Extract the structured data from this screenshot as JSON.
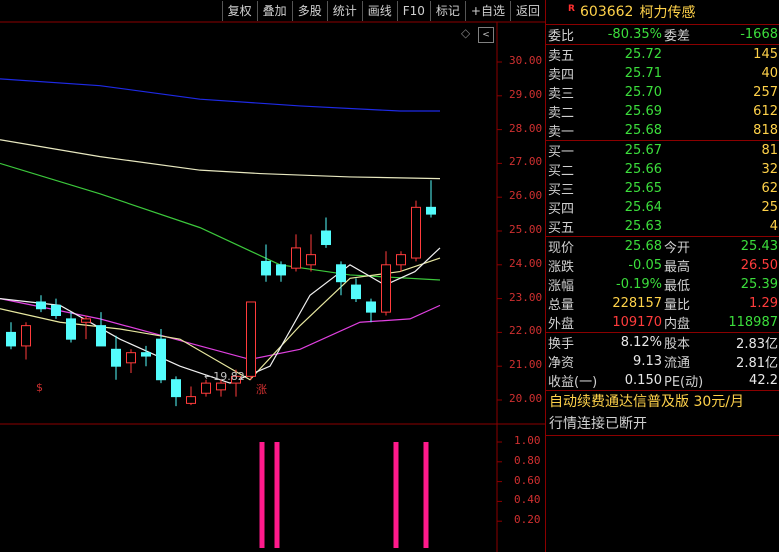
{
  "toolbar": [
    "复权",
    "叠加",
    "多股",
    "统计",
    "画线",
    "F10",
    "标记",
    "+自选",
    "返回"
  ],
  "price_axis": [
    "30.00",
    "29.00",
    "28.00",
    "27.00",
    "26.00",
    "25.00",
    "24.00",
    "23.00",
    "22.00",
    "21.00",
    "20.00"
  ],
  "indicator_axis": [
    "1.00",
    "0.80",
    "0.60",
    "0.40",
    "0.20"
  ],
  "low_annotation": "←19.82",
  "markers": {
    "left": "$",
    "mid": "涨"
  },
  "chart_data": {
    "type": "candlestick",
    "ylim": [
      19.6,
      30.4
    ],
    "candles": [
      {
        "o": 22.0,
        "h": 22.3,
        "l": 21.5,
        "c": 21.6
      },
      {
        "o": 21.6,
        "h": 22.3,
        "l": 21.2,
        "c": 22.2
      },
      {
        "o": 22.9,
        "h": 23.1,
        "l": 22.6,
        "c": 22.7
      },
      {
        "o": 22.8,
        "h": 23.0,
        "l": 22.4,
        "c": 22.5
      },
      {
        "o": 22.4,
        "h": 22.6,
        "l": 21.7,
        "c": 21.8
      },
      {
        "o": 22.3,
        "h": 22.5,
        "l": 21.8,
        "c": 22.4
      },
      {
        "o": 22.2,
        "h": 22.6,
        "l": 21.9,
        "c": 21.6
      },
      {
        "o": 21.5,
        "h": 21.9,
        "l": 20.6,
        "c": 21.0
      },
      {
        "o": 21.1,
        "h": 21.5,
        "l": 20.8,
        "c": 21.4
      },
      {
        "o": 21.4,
        "h": 21.6,
        "l": 21.0,
        "c": 21.3
      },
      {
        "o": 21.8,
        "h": 22.1,
        "l": 20.5,
        "c": 20.6
      },
      {
        "o": 20.6,
        "h": 20.7,
        "l": 19.82,
        "c": 20.1
      },
      {
        "o": 19.9,
        "h": 20.4,
        "l": 19.85,
        "c": 20.1
      },
      {
        "o": 20.2,
        "h": 20.6,
        "l": 20.1,
        "c": 20.5
      },
      {
        "o": 20.3,
        "h": 20.6,
        "l": 20.1,
        "c": 20.5
      },
      {
        "o": 20.5,
        "h": 20.9,
        "l": 20.1,
        "c": 20.7
      },
      {
        "o": 20.7,
        "h": 22.9,
        "l": 20.6,
        "c": 22.9
      },
      {
        "o": 24.1,
        "h": 24.6,
        "l": 23.5,
        "c": 23.7
      },
      {
        "o": 24.0,
        "h": 24.1,
        "l": 23.5,
        "c": 23.7
      },
      {
        "o": 23.9,
        "h": 24.9,
        "l": 23.8,
        "c": 24.5
      },
      {
        "o": 24.0,
        "h": 24.9,
        "l": 23.8,
        "c": 24.3
      },
      {
        "o": 25.0,
        "h": 25.4,
        "l": 24.5,
        "c": 24.6
      },
      {
        "o": 24.0,
        "h": 24.1,
        "l": 23.1,
        "c": 23.5
      },
      {
        "o": 23.4,
        "h": 23.6,
        "l": 22.9,
        "c": 23.0
      },
      {
        "o": 22.9,
        "h": 23.0,
        "l": 22.3,
        "c": 22.6
      },
      {
        "o": 22.6,
        "h": 24.4,
        "l": 22.5,
        "c": 24.0
      },
      {
        "o": 24.0,
        "h": 24.4,
        "l": 23.8,
        "c": 24.3
      },
      {
        "o": 24.2,
        "h": 25.9,
        "l": 24.1,
        "c": 25.7
      },
      {
        "o": 25.7,
        "h": 26.5,
        "l": 25.4,
        "c": 25.5
      }
    ],
    "ma_lines": [
      {
        "color": "#1e2ae6",
        "values": [
          [
            0,
            29.5
          ],
          [
            100,
            29.3
          ],
          [
            200,
            28.9
          ],
          [
            300,
            28.7
          ],
          [
            400,
            28.55
          ],
          [
            440,
            28.55
          ]
        ]
      },
      {
        "color": "#e8e8c0",
        "values": [
          [
            0,
            27.7
          ],
          [
            100,
            27.2
          ],
          [
            200,
            26.8
          ],
          [
            260,
            26.7
          ],
          [
            350,
            26.6
          ],
          [
            440,
            26.55
          ]
        ]
      },
      {
        "color": "#3cc83c",
        "values": [
          [
            0,
            27.0
          ],
          [
            100,
            26.1
          ],
          [
            200,
            25.1
          ],
          [
            280,
            24.0
          ],
          [
            350,
            23.7
          ],
          [
            440,
            23.55
          ]
        ]
      },
      {
        "color": "#e040e0",
        "values": [
          [
            0,
            23.0
          ],
          [
            100,
            22.4
          ],
          [
            200,
            21.6
          ],
          [
            250,
            21.2
          ],
          [
            300,
            21.5
          ],
          [
            360,
            22.3
          ],
          [
            410,
            22.4
          ],
          [
            440,
            22.8
          ]
        ]
      },
      {
        "color": "#e8e8a0",
        "values": [
          [
            0,
            22.7
          ],
          [
            60,
            22.3
          ],
          [
            120,
            22.1
          ],
          [
            180,
            21.8
          ],
          [
            250,
            20.6
          ],
          [
            300,
            22.2
          ],
          [
            350,
            23.6
          ],
          [
            400,
            23.8
          ],
          [
            440,
            24.2
          ]
        ]
      },
      {
        "color": "#f0f0f0",
        "values": [
          [
            0,
            23.0
          ],
          [
            60,
            22.8
          ],
          [
            120,
            21.8
          ],
          [
            180,
            21.0
          ],
          [
            230,
            20.5
          ],
          [
            270,
            21.0
          ],
          [
            310,
            23.1
          ],
          [
            350,
            24.0
          ],
          [
            385,
            23.4
          ],
          [
            415,
            23.8
          ],
          [
            440,
            24.5
          ]
        ]
      }
    ],
    "indicator_bars": [
      {
        "x": 262,
        "v": 1.0
      },
      {
        "x": 277,
        "v": 1.0
      },
      {
        "x": 396,
        "v": 1.0
      },
      {
        "x": 426,
        "v": 1.0
      }
    ]
  },
  "panel": {
    "code": "603662",
    "name": "柯力传感",
    "r_mark": "R",
    "weibi": {
      "label": "委比",
      "value": "-80.35%",
      "label2": "委差",
      "value2": "-1668"
    },
    "asks": [
      {
        "label": "卖五",
        "price": "25.72",
        "vol": "145"
      },
      {
        "label": "卖四",
        "price": "25.71",
        "vol": "40"
      },
      {
        "label": "卖三",
        "price": "25.70",
        "vol": "257"
      },
      {
        "label": "卖二",
        "price": "25.69",
        "vol": "612"
      },
      {
        "label": "卖一",
        "price": "25.68",
        "vol": "818"
      }
    ],
    "bids": [
      {
        "label": "买一",
        "price": "25.67",
        "vol": "81"
      },
      {
        "label": "买二",
        "price": "25.66",
        "vol": "32"
      },
      {
        "label": "买三",
        "price": "25.65",
        "vol": "62"
      },
      {
        "label": "买四",
        "price": "25.64",
        "vol": "25"
      },
      {
        "label": "买五",
        "price": "25.63",
        "vol": "4"
      }
    ],
    "quote": [
      {
        "l1": "现价",
        "v1": "25.68",
        "l2": "今开",
        "v2": "25.43",
        "c1": "green",
        "c2": "green"
      },
      {
        "l1": "涨跌",
        "v1": "-0.05",
        "l2": "最高",
        "v2": "26.50",
        "c1": "green",
        "c2": "red"
      },
      {
        "l1": "涨幅",
        "v1": "-0.19%",
        "l2": "最低",
        "v2": "25.39",
        "c1": "green",
        "c2": "green"
      },
      {
        "l1": "总量",
        "v1": "228157",
        "l2": "量比",
        "v2": "1.29",
        "c1": "yellow",
        "c2": "red"
      },
      {
        "l1": "外盘",
        "v1": "109170",
        "l2": "内盘",
        "v2": "118987",
        "c1": "red",
        "c2": "green"
      }
    ],
    "stats": [
      {
        "l1": "换手",
        "v1": "8.12%",
        "l2": "股本",
        "v2": "2.83亿"
      },
      {
        "l1": "净资",
        "v1": "9.13",
        "l2": "流通",
        "v2": "2.81亿"
      },
      {
        "l1": "收益(一)",
        "v1": "0.150",
        "l2": "PE(动)",
        "v2": "42.2"
      }
    ],
    "ad": "自动续费通达信普及版  30元/月",
    "status": "行情连接已断开"
  }
}
